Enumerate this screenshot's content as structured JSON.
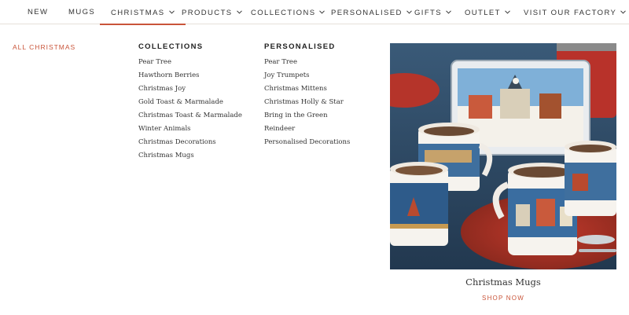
{
  "nav": {
    "items": [
      {
        "label": "NEW",
        "has_dropdown": false
      },
      {
        "label": "MUGS",
        "has_dropdown": false
      },
      {
        "label": "CHRISTMAS",
        "has_dropdown": true
      },
      {
        "label": "PRODUCTS",
        "has_dropdown": true
      },
      {
        "label": "COLLECTIONS",
        "has_dropdown": true
      },
      {
        "label": "PERSONALISED",
        "has_dropdown": true
      },
      {
        "label": "GIFTS",
        "has_dropdown": true
      },
      {
        "label": "OUTLET",
        "has_dropdown": true
      },
      {
        "label": "VISIT OUR FACTORY",
        "has_dropdown": true
      }
    ],
    "active_index": 2,
    "chevron_icon": "chevron-down-icon"
  },
  "menu": {
    "all_link": "ALL CHRISTMAS",
    "columns": [
      {
        "heading": "COLLECTIONS",
        "links": [
          "Pear Tree",
          "Hawthorn Berries",
          "Christmas Joy",
          "Gold Toast & Marmalade",
          "Christmas Toast & Marmalade",
          "Winter Animals",
          "Christmas Decorations",
          "Christmas Mugs"
        ]
      },
      {
        "heading": "PERSONALISED",
        "links": [
          "Pear Tree",
          "Joy Trumpets",
          "Christmas Mittens",
          "Christmas Holly & Star",
          "Bring in the Green",
          "Reindeer",
          "Personalised Decorations"
        ]
      }
    ],
    "feature": {
      "caption": "Christmas Mugs",
      "cta": "SHOP NOW"
    }
  },
  "colors": {
    "accent": "#c9553a",
    "nav_text": "#333333",
    "divider": "#e6e0da"
  }
}
